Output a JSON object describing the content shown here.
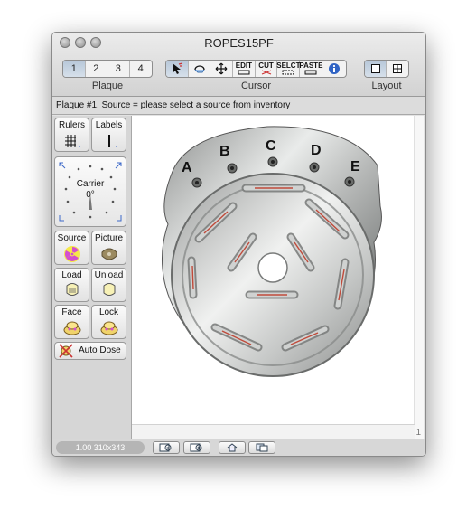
{
  "window": {
    "title": "ROPES15PF"
  },
  "toolbar": {
    "plaque": {
      "label": "Plaque",
      "buttons": [
        "1",
        "2",
        "3",
        "4"
      ],
      "selected": "1"
    },
    "cursor": {
      "label": "Cursor",
      "tools": [
        {
          "name": "select-arrow",
          "label": ""
        },
        {
          "name": "rotate",
          "label": ""
        },
        {
          "name": "move",
          "label": ""
        },
        {
          "name": "edit",
          "label": "EDIT"
        },
        {
          "name": "cut",
          "label": "CUT"
        },
        {
          "name": "select",
          "label": "SELCT"
        },
        {
          "name": "paste",
          "label": "PASTE"
        },
        {
          "name": "info",
          "label": "i"
        }
      ]
    },
    "layout": {
      "label": "Layout",
      "selected": "single"
    }
  },
  "infobar": {
    "text": "Plaque #1, Source = please select a source from inventory"
  },
  "sidebar": {
    "rulers": "Rulers",
    "labels": "Labels",
    "carrier": {
      "label": "Carrier",
      "angle": "0°"
    },
    "source": "Source",
    "picture": "Picture",
    "load": "Load",
    "unload": "Unload",
    "face": "Face",
    "lock": "Lock",
    "auto_dose": "Auto Dose"
  },
  "plaque": {
    "hole_labels": [
      "A",
      "B",
      "C",
      "D",
      "E"
    ]
  },
  "canvas": {
    "page_number": "1"
  },
  "status": {
    "zoom": "1.00 310x343"
  },
  "colors": {
    "accent_selected": "#b7c7d8",
    "radiation": "#d34fd0",
    "seed_line": "#c04a3a"
  }
}
